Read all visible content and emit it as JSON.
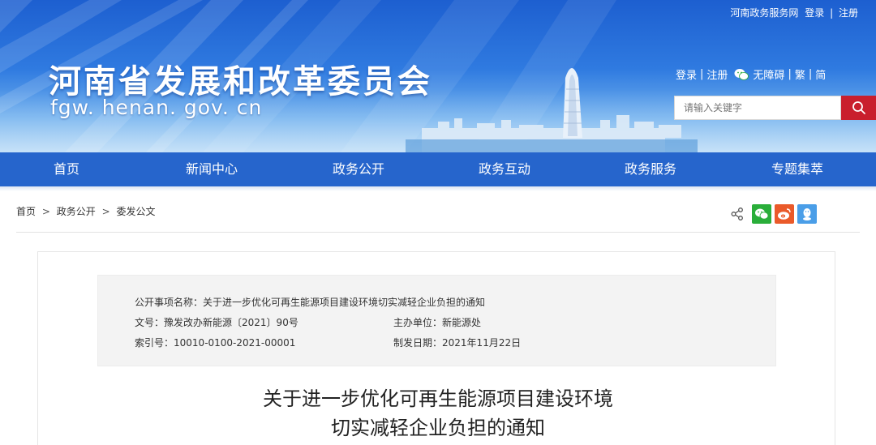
{
  "topbar": {
    "portal": "河南政务服务网",
    "login": "登录",
    "sep": "|",
    "register": "注册"
  },
  "site": {
    "title": "河南省发展和改革委员会",
    "url": "fgw. henan. gov. cn"
  },
  "util": {
    "login": "登录",
    "register": "注册",
    "barrier_free": "无障碍",
    "traditional": "繁",
    "simplified": "简",
    "sep": "|"
  },
  "search": {
    "placeholder": "请输入关键字",
    "icon": "search-icon"
  },
  "nav": {
    "items": [
      "首页",
      "新闻中心",
      "政务公开",
      "政务互动",
      "政务服务",
      "专题集萃"
    ]
  },
  "breadcrumb": {
    "items": [
      "首页",
      "政务公开",
      "委发公文"
    ],
    "sep": ">"
  },
  "share": {
    "icons": [
      "share-icon",
      "wechat-icon",
      "weibo-icon",
      "qq-icon"
    ]
  },
  "info": {
    "item_name_label": "公开事项名称：",
    "item_name": "关于进一步优化可再生能源项目建设环境切实减轻企业负担的通知",
    "doc_no_label": "文号：",
    "doc_no": "豫发改办新能源〔2021〕90号",
    "dept_label": "主办单位：",
    "dept": "新能源处",
    "index_label": "索引号：",
    "index": "10010-0100-2021-00001",
    "date_label": "制发日期：",
    "date": "2021年11月22日"
  },
  "article": {
    "title_line1": "关于进一步优化可再生能源项目建设环境",
    "title_line2": "切实减轻企业负担的通知"
  },
  "colors": {
    "nav": "#2665cc",
    "search_button": "#c91f2d",
    "wechat": "#2aae3a",
    "weibo": "#ea5a2a",
    "qq": "#4a9ee8",
    "info_bg": "#f3f3f3"
  }
}
